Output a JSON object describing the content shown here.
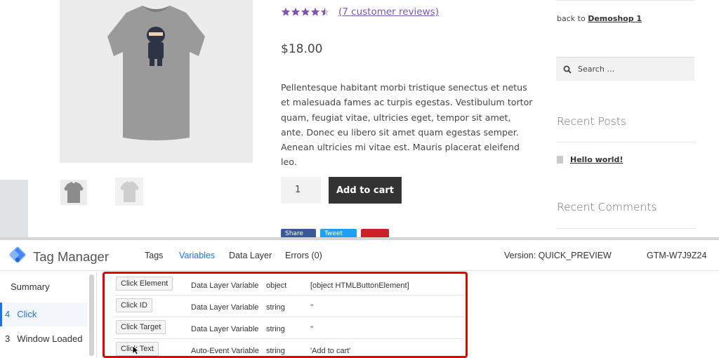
{
  "product": {
    "rating_value": 4.5,
    "rating_max": 5,
    "review_link": "(7 customer reviews)",
    "price": "$18.00",
    "description": "Pellentesque habitant morbi tristique senectus et netus et malesuada fames ac turpis egestas. Vestibulum tortor quam, feugiat vitae, ultricies eget, tempor sit amet, ante. Donec eu libero sit amet quam egestas semper. Aenean ultricies mi vitae est. Mauris placerat eleifend leo.",
    "quantity": "1",
    "add_to_cart": "Add to cart",
    "share": [
      "Share",
      "Tweet",
      ""
    ]
  },
  "sidebar": {
    "back_prefix": "back to ",
    "back_link": "Demoshop 1",
    "search_placeholder": "Search …",
    "recent_posts_title": "Recent Posts",
    "post_link": "Hello world!",
    "recent_comments_title": "Recent Comments"
  },
  "gtm": {
    "title": "Tag Manager",
    "nav": {
      "tags": "Tags",
      "variables": "Variables",
      "data_layer": "Data Layer",
      "errors": "Errors (0)"
    },
    "version": "Version: QUICK_PREVIEW",
    "container_id": "GTM-W7J9Z24",
    "events": [
      {
        "num": "",
        "label": "Summary"
      },
      {
        "num": "4",
        "label": "Click"
      },
      {
        "num": "3",
        "label": "Window Loaded"
      }
    ],
    "variables": [
      {
        "name": "Click Element",
        "type": "Data Layer Variable",
        "return_type": "object",
        "value": "[object HTMLButtonElement]"
      },
      {
        "name": "Click ID",
        "type": "Data Layer Variable",
        "return_type": "string",
        "value": "''"
      },
      {
        "name": "Click Target",
        "type": "Data Layer Variable",
        "return_type": "string",
        "value": "''"
      },
      {
        "name": "Click Text",
        "type": "Auto-Event Variable",
        "return_type": "string",
        "value": "'Add to cart'"
      }
    ]
  },
  "colors": {
    "accent_purple": "#7f54b3",
    "gtm_blue": "#1a73e8",
    "highlight_red": "#e60000",
    "button_dark": "#333333"
  }
}
